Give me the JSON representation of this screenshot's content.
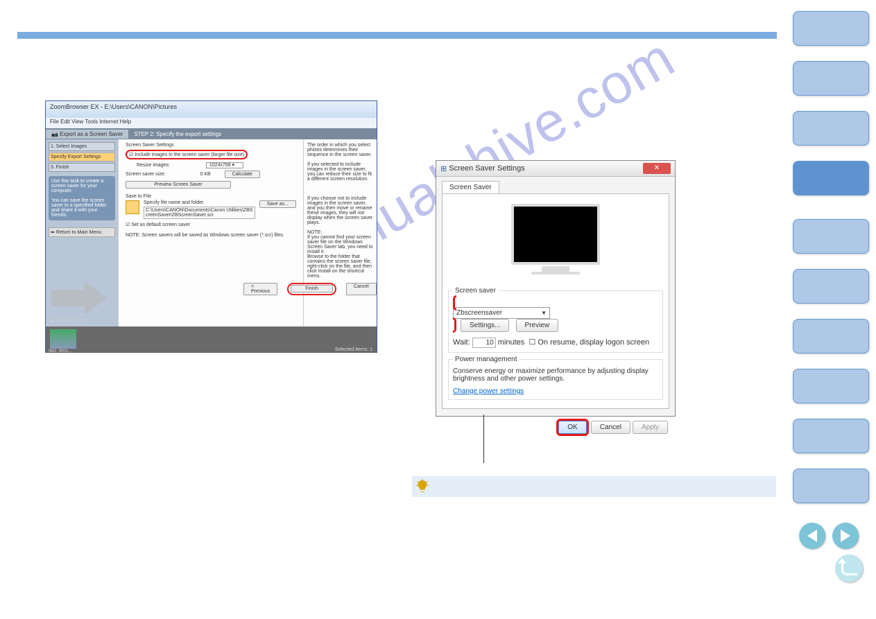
{
  "watermark": "manualshive.com",
  "zb": {
    "window_title": "ZoomBrowser EX - E:\\Users\\CANON\\Pictures",
    "menus": "File   Edit   View   Tools   Internet   Help",
    "header_left": "Export as a Screen Saver",
    "header_right": "STEP 2: Specify the export settings",
    "side_step1": "1.   Select Images",
    "side_step2": "Specify Export Settings",
    "side_step3": "3.   Finish",
    "side_hint1": "Use this task to create a screen saver for your computer.",
    "side_hint2": "You can save the screen saver to a specified folder and share it with your friends.",
    "side_ret": "Return to Main Menu",
    "sec1": "Screen Saver Settings",
    "checkbox": "Include images in the screen saver (larger file size)",
    "resize_lbl": "Resize images:",
    "resize_val": "1024x768",
    "size_lbl": "Screen saver size:",
    "size_val": "0 KB",
    "calc": "Calculate",
    "preview": "Preview Screen Saver",
    "sec2": "Save to File",
    "savefile_lbl": "Specify file name and folder.",
    "saveas": "Save as...",
    "path": "C:\\Users\\CANON\\Documents\\Canon Utilities\\ZBScreenSaver\\ZBScreenSaver.scr",
    "setdef": "Set as default screen saver",
    "note": "NOTE: Screen savers will be saved as Windows screen saver (*.scr) files.",
    "r_p1": "The order in which you select photos determines their sequence in the screen saver.",
    "r_p2": "If you selected to include images in the screen saver, you can reduce their size to fit a different screen resolution.",
    "r_p3": "If you choose not to include images in the screen saver, and you then move or rename these images, they will not display when the screen saver plays.",
    "r_note_h": "NOTE:",
    "r_note": "If you cannot find your screen saver file on the Windows Screen Saver tab, you need to install it.\nBrowse to the folder that contains the screen saver file, right-click on the file, and then click Install on the shortcut menu.",
    "prev_btn": "< Previous",
    "finish_btn": "Finish",
    "cancel_btn": "Cancel",
    "sel_items": "Selected Items",
    "thumb_name": "IMG_0001...",
    "status": "Selected Items: 1"
  },
  "ss": {
    "title": "Screen Saver Settings",
    "tab": "Screen Saver",
    "group1": "Screen saver",
    "dd_val": "Zbscreensaver",
    "settings": "Settings...",
    "preview": "Preview",
    "wait_lbl": "Wait:",
    "wait_val": "10",
    "wait_unit": "minutes",
    "resume": "On resume, display logon screen",
    "group2": "Power management",
    "pm_text": "Conserve energy or maximize performance by adjusting display brightness and other power settings.",
    "pm_link": "Change power settings",
    "ok": "OK",
    "cancel": "Cancel",
    "apply": "Apply"
  }
}
